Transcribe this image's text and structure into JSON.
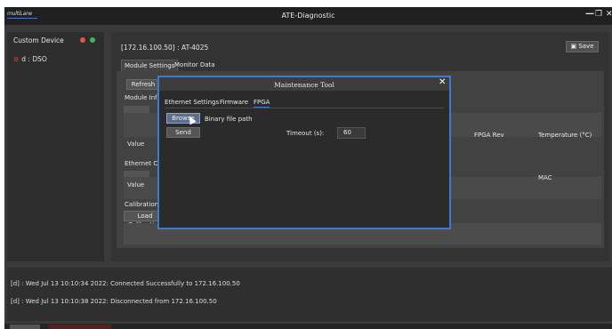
{
  "titlebar": {
    "brand": "multiLane",
    "title": "ATE-Diagnostic",
    "minimize": "—",
    "restore": "❐",
    "close": "✕"
  },
  "sidebar": {
    "title": "Custom Device",
    "status_colors": {
      "red": "#e0554a",
      "green": "#3fb85a"
    },
    "items": [
      {
        "label": "d : DSO",
        "icon": "gear-icon",
        "icon_glyph": "⚙"
      }
    ]
  },
  "main": {
    "address": "[172.16.100.50] : AT-4025",
    "save_label": "Save",
    "save_icon": "floppy-disk-icon",
    "tabs": [
      {
        "label": "Module Settings",
        "active": true
      },
      {
        "label": "Monitor Data",
        "active": false
      }
    ],
    "refresh_label": "Refresh",
    "module_info_label": "Module Info",
    "module_value_label": "Value",
    "fpga_rev_header": "FPGA Rev",
    "temperature_header": "Temperature (°C)",
    "ethernet_label": "Ethernet Conn",
    "ethernet_value_label": "Value",
    "mac_header": "MAC",
    "calibration_label": "Calibration File",
    "load_calibration_label": "Load Calibration"
  },
  "dialog": {
    "title": "Maintenance Tool",
    "close": "✕",
    "tabs": [
      {
        "label": "Ethernet Settings",
        "active": false
      },
      {
        "label": "Firmware",
        "active": false
      },
      {
        "label": "FPGA",
        "active": true
      }
    ],
    "browse_label": "Browse",
    "file_path_label": "Binary file path",
    "send_label": "Send",
    "timeout_label": "Timeout (s):",
    "timeout_value": "60",
    "accent": "#3b7bd4"
  },
  "log": [
    "[d] : Wed Jul 13 10:10:34 2022: Connected Successfully to 172.16.100.50",
    "[d] : Wed Jul 13 10:10:38 2022: Disconnected from 172.16.100.50"
  ]
}
